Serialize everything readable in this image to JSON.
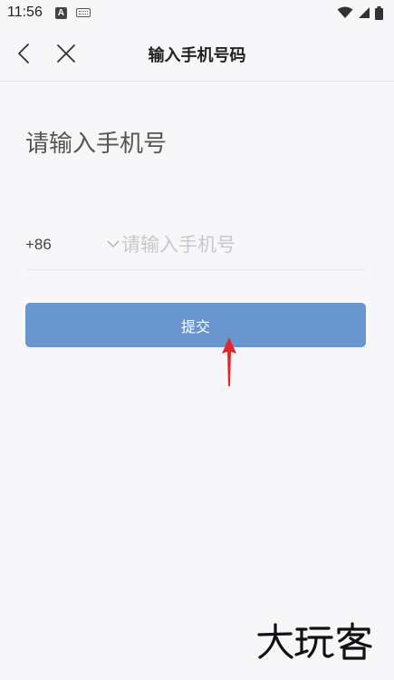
{
  "status_bar": {
    "time": "11:56",
    "icons": [
      "a-icon",
      "keyboard-icon",
      "wifi-icon",
      "signal-icon",
      "battery-icon"
    ]
  },
  "nav": {
    "title": "输入手机号码",
    "back_icon": "chevron-left-icon",
    "close_icon": "close-icon"
  },
  "main": {
    "heading": "请输入手机号",
    "country_code": "+86",
    "phone_placeholder": "请输入手机号",
    "phone_value": "",
    "submit_label": "提交"
  },
  "colors": {
    "accent": "#6a96cf",
    "arrow": "#e8232a"
  },
  "watermark": {
    "text": "大玩客"
  }
}
